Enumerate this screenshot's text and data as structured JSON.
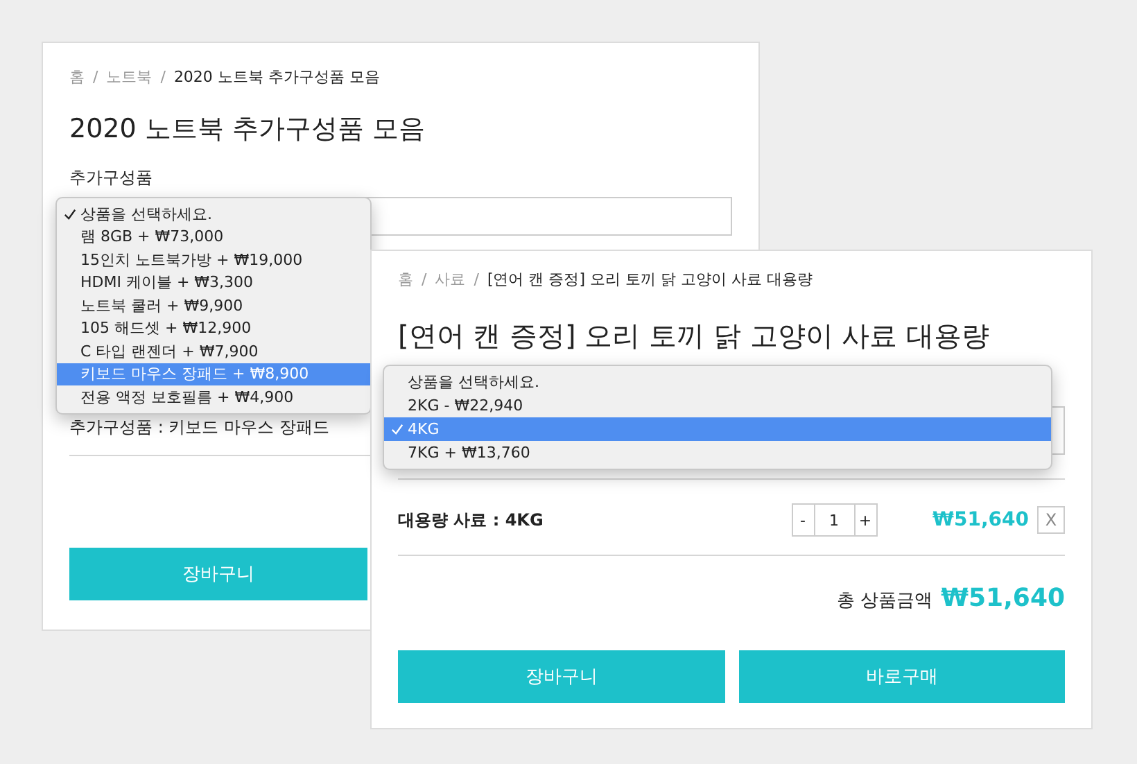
{
  "panels": [
    {
      "separator": "/",
      "breadcrumb": [
        "홈",
        "노트북",
        "2020 노트북 추가구성품 모음"
      ],
      "title": "2020 노트북 추가구성품 모음",
      "field_label": "추가구성품",
      "dropdown": [
        {
          "label": "상품을 선택하세요.",
          "checked": true,
          "highlighted": false
        },
        {
          "label": "램 8GB + ₩73,000",
          "checked": false,
          "highlighted": false
        },
        {
          "label": "15인치 노트북가방 + ₩19,000",
          "checked": false,
          "highlighted": false
        },
        {
          "label": "HDMI 케이블 + ₩3,300",
          "checked": false,
          "highlighted": false
        },
        {
          "label": "노트북 쿨러 + ₩9,900",
          "checked": false,
          "highlighted": false
        },
        {
          "label": "105 해드셋 + ₩12,900",
          "checked": false,
          "highlighted": false
        },
        {
          "label": "C 타입 랜젠더 + ₩7,900",
          "checked": false,
          "highlighted": false
        },
        {
          "label": "키보드 마우스 장패드 + ₩8,900",
          "checked": false,
          "highlighted": true
        },
        {
          "label": "전용 액정 보호필름 + ₩4,900",
          "checked": false,
          "highlighted": false
        }
      ],
      "selection": "추가구성품 : 키보드 마우스 장패드",
      "buttons": [
        "장바구니"
      ]
    },
    {
      "separator": "/",
      "breadcrumb": [
        "홈",
        "사료",
        "[연어 캔 증정] 오리 토끼 닭 고양이 사료 대용량"
      ],
      "title": "[연어 캔 증정] 오리 토끼 닭 고양이 사료 대용량",
      "dropdown": [
        {
          "label": "상품을 선택하세요.",
          "checked": false,
          "highlighted": false
        },
        {
          "label": "2KG - ₩22,940",
          "checked": false,
          "highlighted": false
        },
        {
          "label": "4KG",
          "checked": true,
          "highlighted": true
        },
        {
          "label": "7KG + ₩13,760",
          "checked": false,
          "highlighted": false
        }
      ],
      "line_item": {
        "name": "대용량 사료 : 4KG",
        "decrement": "-",
        "quantity": "1",
        "increment": "+",
        "price": "₩51,640",
        "remove": "X"
      },
      "total": {
        "label": "총 상품금액",
        "amount": "₩51,640"
      },
      "buttons": [
        "장바구니",
        "바로구매"
      ]
    }
  ]
}
